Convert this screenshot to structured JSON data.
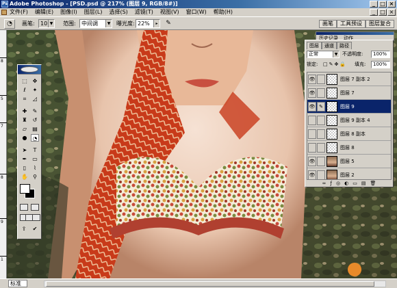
{
  "window": {
    "title": "Adobe Photoshop - [PSD.psd @ 217% (图层 9, RGB/8#)]",
    "controls": [
      "_",
      "□",
      "×"
    ]
  },
  "menu": {
    "items": [
      "文件(F)",
      "编辑(E)",
      "图像(I)",
      "图层(L)",
      "选择(S)",
      "滤镜(T)",
      "视图(V)",
      "窗口(W)",
      "帮助(H)"
    ],
    "doc_controls": [
      "_",
      "□",
      "×"
    ]
  },
  "options": {
    "brush_label": "画笔:",
    "brush_size": "10",
    "range_label": "范围:",
    "range_value": "中间调",
    "exposure_label": "曝光度:",
    "exposure_value": "22%",
    "dock_tabs": [
      "画笔",
      "工具预设",
      "图层复合"
    ]
  },
  "docked_panel": {
    "tabs": [
      "历史记录",
      "动作"
    ]
  },
  "ruler": {
    "numbers": [
      "8",
      "5",
      "7",
      "8",
      "9",
      "1"
    ]
  },
  "layers_panel": {
    "tabs": [
      "图层",
      "通道",
      "路径"
    ],
    "blend_mode": "正常",
    "opacity_label": "不透明度:",
    "opacity_value": "100%",
    "lock_label": "锁定:",
    "fill_label": "填充:",
    "fill_value": "100%",
    "layers": [
      {
        "name": "图层 7 副本 2",
        "visible": true,
        "selected": false,
        "thumb": "transparent"
      },
      {
        "name": "图层 7",
        "visible": true,
        "selected": false,
        "thumb": "transparent"
      },
      {
        "name": "图层 9",
        "visible": true,
        "selected": true,
        "thumb": "transparent"
      },
      {
        "name": "图层 9 副本 4",
        "visible": false,
        "selected": false,
        "thumb": "transparent"
      },
      {
        "name": "图层 8 副本",
        "visible": false,
        "selected": false,
        "thumb": "transparent"
      },
      {
        "name": "图层 8",
        "visible": false,
        "selected": false,
        "thumb": "transparent"
      },
      {
        "name": "图层 5",
        "visible": true,
        "selected": false,
        "thumb": "photo"
      },
      {
        "name": "图层 2",
        "visible": true,
        "selected": false,
        "thumb": "photo"
      }
    ],
    "bottom_icons": [
      "∞",
      "ƒ",
      "◎",
      "◐",
      "▭",
      "▤",
      "🗑"
    ]
  },
  "status": {
    "zoom": "标准"
  },
  "colors": {
    "title_gradient_start": "#0a246a",
    "title_gradient_end": "#a6caf0",
    "selected_layer": "#0a246a",
    "ui_face": "#d4d0c8"
  }
}
